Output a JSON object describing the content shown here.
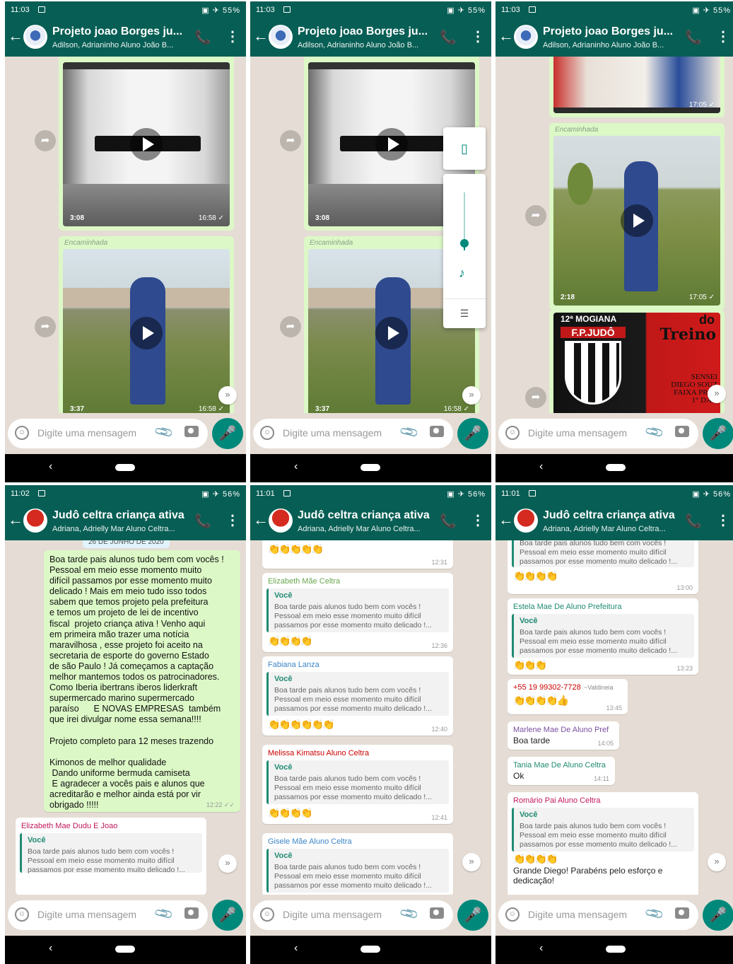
{
  "status": [
    {
      "time": "11:03",
      "icons": "▣ ✈ 55%"
    },
    {
      "time": "11:03",
      "icons": "▣ ✈ 55%"
    },
    {
      "time": "11:03",
      "icons": "▣ ✈ 55%"
    },
    {
      "time": "11:02",
      "icons": "▣ ✈ 56%"
    },
    {
      "time": "11:01",
      "icons": "▣ ✈ 56%"
    },
    {
      "time": "11:01",
      "icons": "▣ ✈ 56%"
    }
  ],
  "headers": [
    {
      "title": "Projeto joao Borges ju...",
      "subtitle": "Adilson, Adrianinho Aluno João B..."
    },
    {
      "title": "Projeto joao Borges ju...",
      "subtitle": "Adilson, Adrianinho Aluno João B..."
    },
    {
      "title": "Projeto joao Borges ju...",
      "subtitle": "Adilson, Adrianinho Aluno João B..."
    },
    {
      "title": "Judô celtra criança ativa",
      "subtitle": "Adriana, Adrielly Mar Aluno Celtra..."
    },
    {
      "title": "Judô celtra criança ativa",
      "subtitle": "Adriana, Adrielly Mar Aluno Celtra..."
    },
    {
      "title": "Judô celtra criança ativa",
      "subtitle": "Adriana, Adrielly Mar Aluno Celtra..."
    }
  ],
  "input_placeholder": "Digite uma mensagem",
  "forwarded_label": "Encaminhada",
  "p1": {
    "v1": {
      "dur": "3:08",
      "time": "16:58 ✓"
    },
    "v2": {
      "dur": "3:37",
      "time": "16:58 ✓"
    }
  },
  "p3": {
    "v0_time": "17:05 ✓",
    "v2": {
      "dur": "2:18",
      "time": "17:05 ✓"
    },
    "poster": {
      "l1": "12ª MOGIANA",
      "l2": "F.P.JUDÔ",
      "l3": "do",
      "l4": "Treino",
      "l5": "SENSEI",
      "l6": "DIEGO SOUZ",
      "l7": "FAIXA PRET",
      "l8": "1° DAN"
    }
  },
  "p4": {
    "date": "26 DE JUNHO DE 2020",
    "long_message": "Boa tarde pais alunos tudo bem com vocês !\nPessoal em meio esse momento muito\ndifícil passamos por esse momento muito\ndelicado ! Mais em meio tudo isso todos\nsabem que temos projeto pela prefeitura\ne temos um projeto de lei de incentivo\nfiscal  projeto criança ativa ! Venho aqui\nem primeira mão trazer uma notícia\nmaravilhosa , esse projeto foi aceito na\nsecretaria de esporte do governo Estado\nde são Paulo ! Já começamos a captação\nmelhor mantemos todos os patrocinadores.\nComo Iberia ibertrans iberos liderkraft\nsupermercado marino supermercado\nparaíso      E NOVAS EMPRESAS  também\nque irei divulgar nome essa semana!!!!\n\nProjeto completo para 12 meses trazendo\n\nKimonos de melhor qualidade\n Dando uniforme bermuda camiseta\n E agradecer a vocês pais e alunos que\nacreditarão e melhor ainda está por vir\nobrigado !!!!!",
    "long_time": "12:22 ✓✓",
    "reply_sender": "Elizabeth Mae Dudu E Joao"
  },
  "quote": {
    "author": "Você",
    "text": "Boa tarde pais alunos tudo bem com vocês !\nPessoal em meio esse momento muito difícil\npassamos por esse momento muito delicado !..."
  },
  "p5": [
    {
      "sender": "",
      "time": "12:31",
      "claps": "👏👏👏👏👏",
      "color": "#1f8b72"
    },
    {
      "sender": "Elizabeth Mãe Celtra",
      "time": "12:36",
      "claps": "👏👏👏👏",
      "color": "#6aa84f"
    },
    {
      "sender": "Fabiana Lanza",
      "time": "12:40",
      "claps": "👏👏👏👏👏👏",
      "color": "#3d85c6"
    },
    {
      "sender": "Melissa Kimatsu Aluno Celtra",
      "time": "12:41",
      "claps": "👏👏👏👏",
      "color": "#cc0000"
    },
    {
      "sender": "Gisele Mãe Aluno Celtra",
      "time": "",
      "claps": "",
      "color": "#3d85c6"
    }
  ],
  "p6": {
    "top_time": "13:00",
    "estela": {
      "sender": "Estela Mae De Aluno Prefeitura",
      "time": "13:23",
      "claps": "👏👏👏"
    },
    "phone": {
      "sender": "+55 19 99302-7728",
      "alias": "~Valdineia",
      "time": "13:45",
      "claps": "👏👏👏👏👍"
    },
    "marlene": {
      "sender": "Marlene Mae De Aluno Pref",
      "text": "Boa tarde",
      "time": "14:05"
    },
    "tania": {
      "sender": "Tania Mae De Aluno Celtra",
      "text": "Ok",
      "time": "14:11"
    },
    "romario": {
      "sender": "Romário Pai Aluno Celtra",
      "claps": "👏👏👏👏",
      "text": "Grande Diego! Parabéns pelo esforço e dedicação!"
    }
  },
  "colors": {
    "header": "#075e54",
    "outgoing": "#dcf8c6",
    "mic": "#00897b"
  }
}
